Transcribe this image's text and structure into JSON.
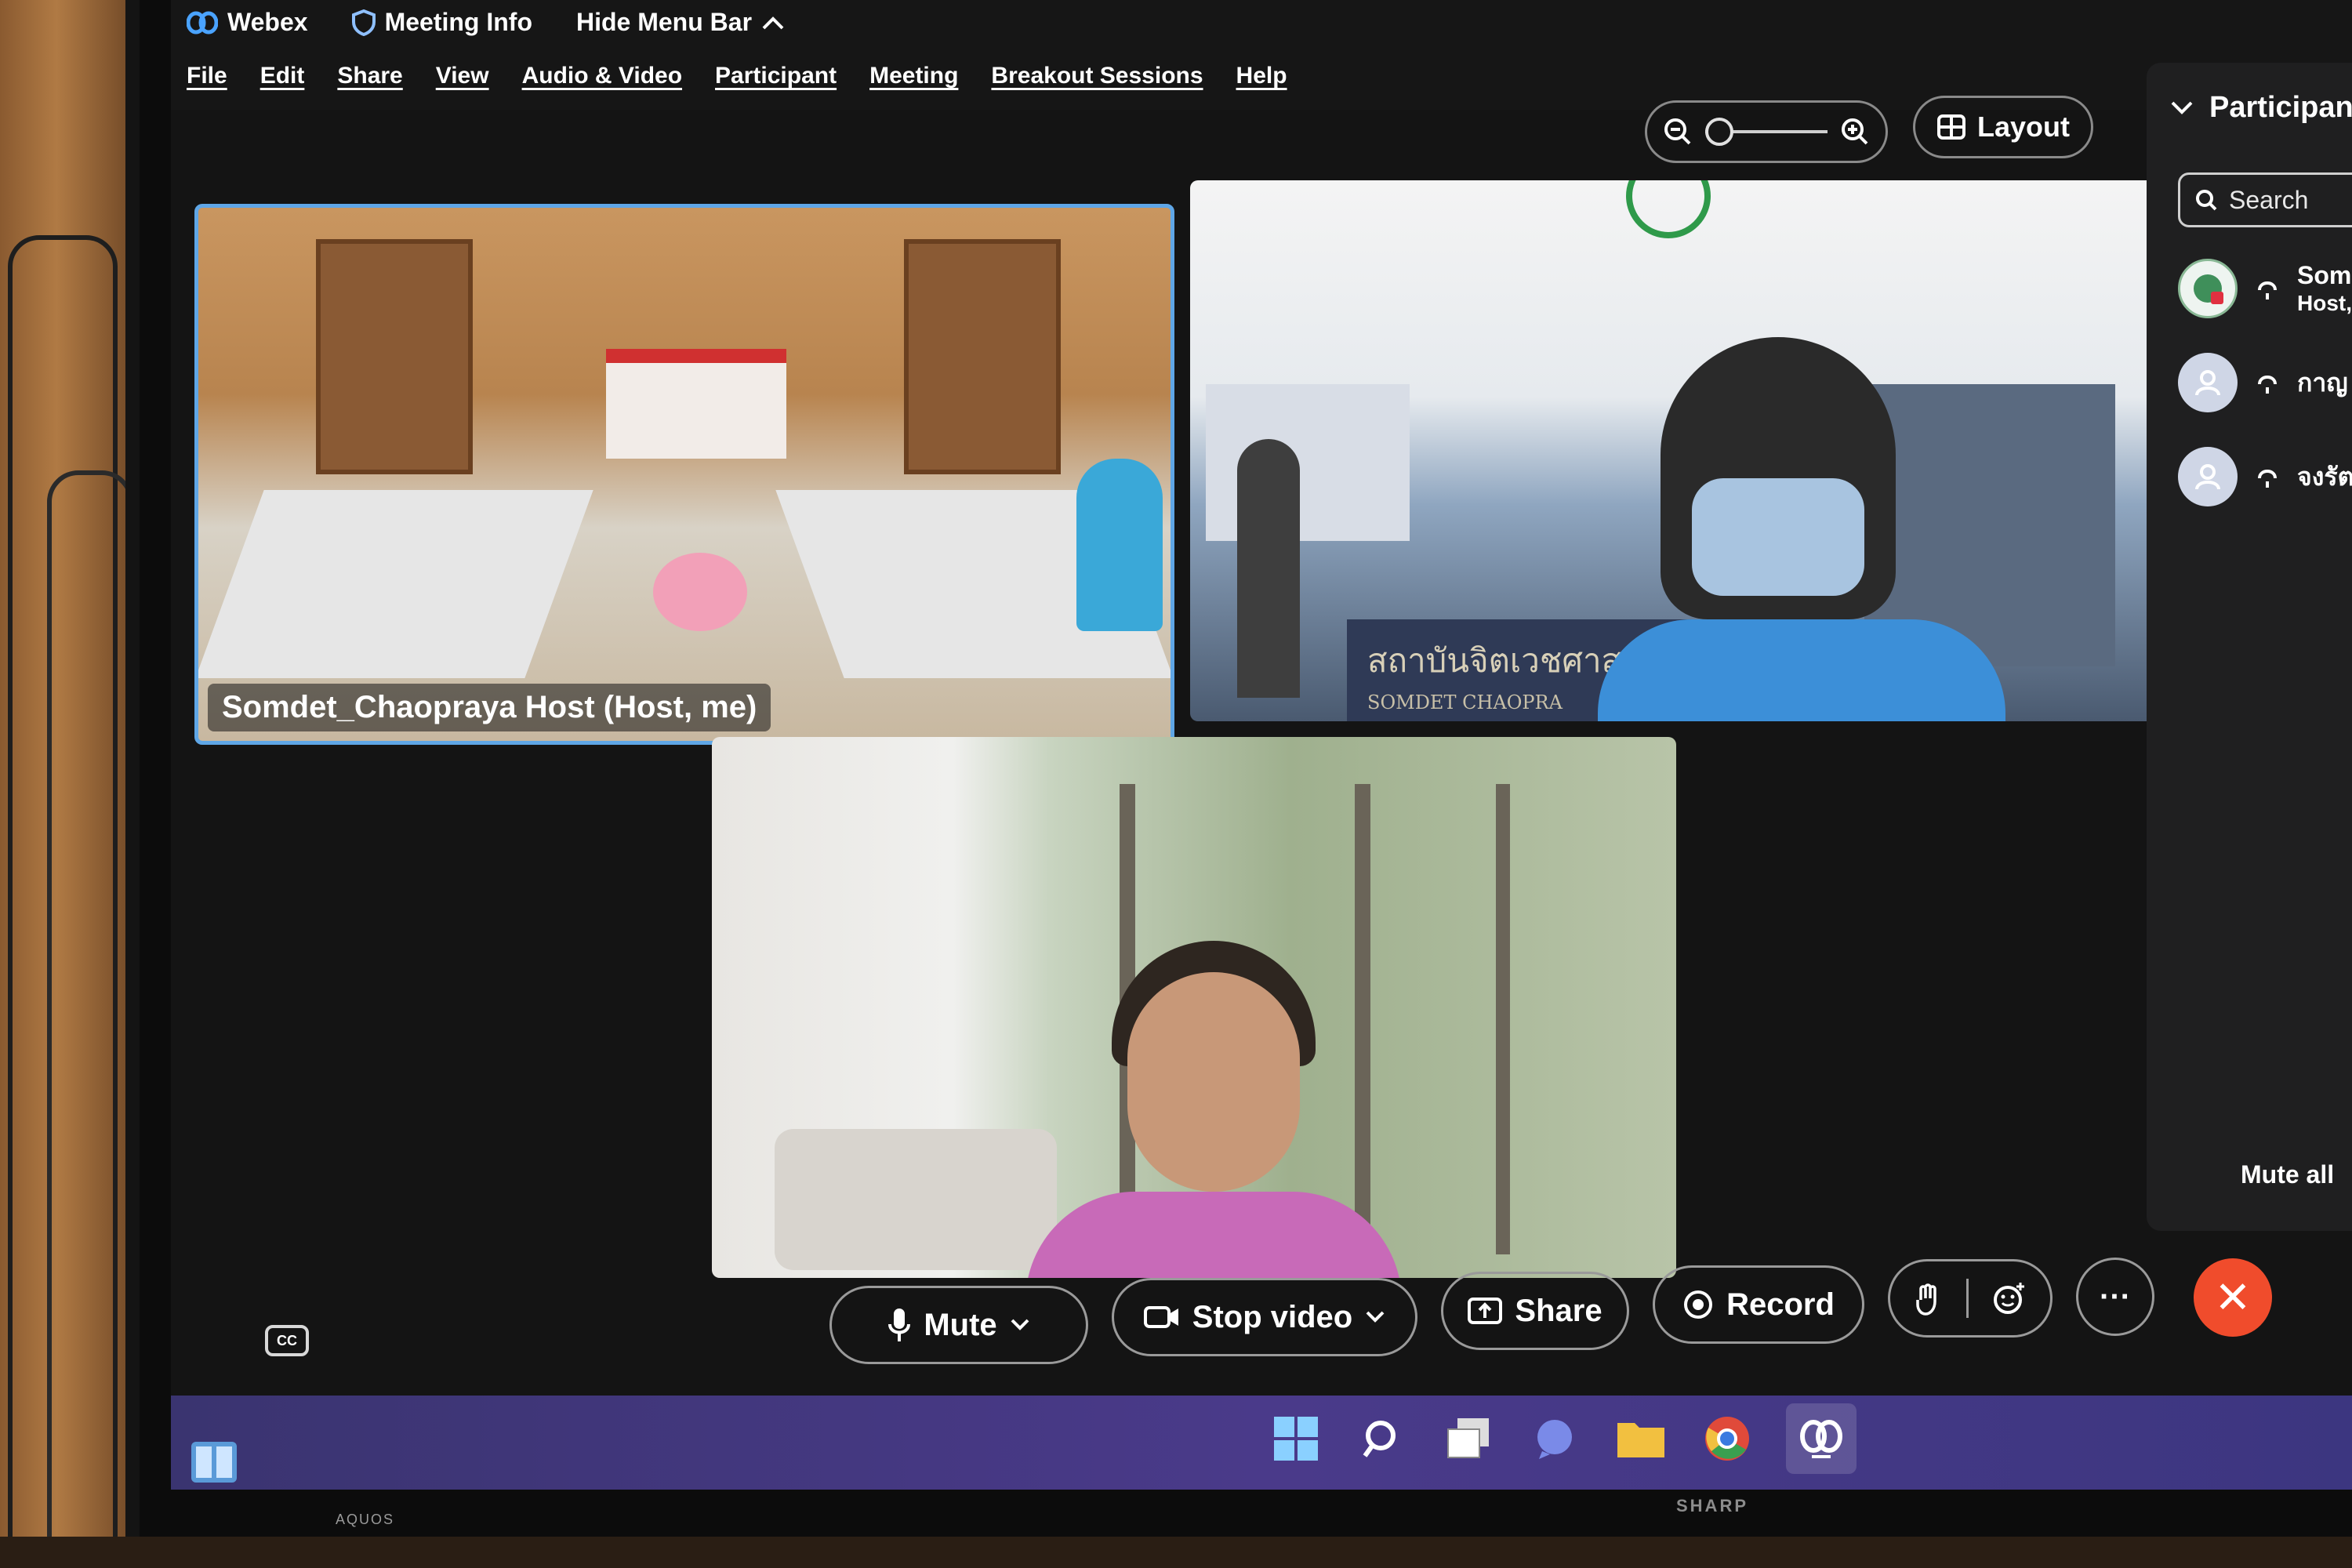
{
  "topbar": {
    "app_name": "Webex",
    "meeting_info": "Meeting Info",
    "hide_menu_bar": "Hide Menu Bar"
  },
  "menu": {
    "items": [
      "File",
      "Edit",
      "Share",
      "View",
      "Audio & Video",
      "Participant",
      "Meeting",
      "Breakout Sessions",
      "Help"
    ]
  },
  "view": {
    "layout_label": "Layout",
    "zoom_level": 0
  },
  "tiles": {
    "host_label": "Somdet_Chaopraya Host (Host, me)",
    "sign_text": "สถาบันจิตเวชศาส",
    "sign_subtext": "SOMDET CHAOPRA"
  },
  "participants": {
    "title": "Participants",
    "search_placeholder": "Search",
    "list": [
      {
        "name": "Som",
        "role": "Host,"
      },
      {
        "name": "กาญ",
        "role": ""
      },
      {
        "name": "จงรัต",
        "role": ""
      }
    ],
    "mute_all": "Mute all"
  },
  "controls": {
    "mute": "Mute",
    "stop_video": "Stop video",
    "share": "Share",
    "record": "Record",
    "more": "···"
  },
  "monitor": {
    "brand_left": "AQUOS",
    "brand_center": "SHARP"
  },
  "colors": {
    "active_tile_border": "#5fa6e6",
    "leave_button": "#f04c2c",
    "taskbar": "#4a3a8a"
  }
}
